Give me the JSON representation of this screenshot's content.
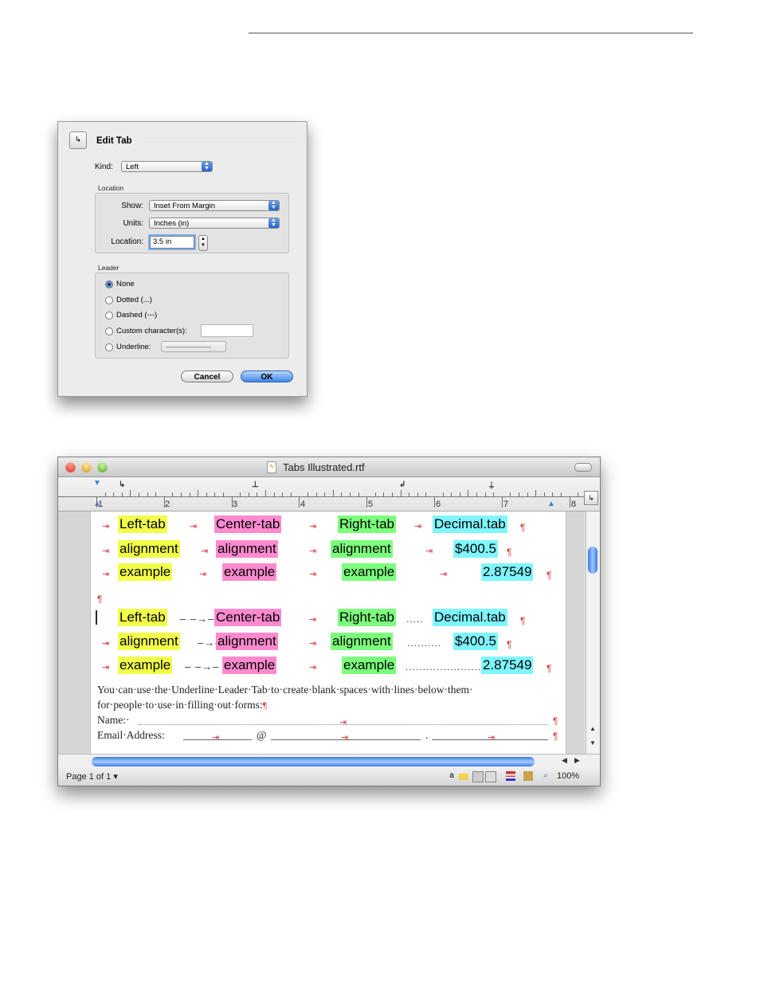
{
  "dialog": {
    "title": "Edit Tab",
    "kind_label": "Kind:",
    "kind_value": "Left",
    "location_group": "Location",
    "show_label": "Show:",
    "show_value": "Inset From Margin",
    "units_label": "Units:",
    "units_value": "Inches (in)",
    "location_label": "Location:",
    "location_value": "3.5 in",
    "leader_group": "Leader",
    "leaders": [
      {
        "label": "None",
        "selected": true
      },
      {
        "label": "Dotted (...)",
        "selected": false
      },
      {
        "label": "Dashed (---)",
        "selected": false
      },
      {
        "label": "Custom character(s):",
        "selected": false
      },
      {
        "label": "Underline:",
        "selected": false
      }
    ],
    "cancel_label": "Cancel",
    "ok_label": "OK"
  },
  "window": {
    "title": "Tabs Illustrated.rtf",
    "ruler_numbers": [
      "1",
      "2",
      "3",
      "4",
      "5",
      "6",
      "7",
      "8"
    ],
    "status": {
      "page_count": "Page 1 of 1 ▾",
      "zoom": "100%"
    }
  },
  "document": {
    "block1": [
      {
        "left": "Left-tab",
        "center": "Center-tab",
        "right": "Right-tab",
        "decimal": "Decimal.tab"
      },
      {
        "left": "alignment",
        "center": "alignment",
        "right": "alignment",
        "decimal": "$400.5"
      },
      {
        "left": "example",
        "center": "example",
        "right": "example",
        "decimal": "2.87549"
      }
    ],
    "block2": [
      {
        "left": "Left-tab",
        "center": "Center-tab",
        "right": "Right-tab",
        "decimal": "Decimal.tab"
      },
      {
        "left": "alignment",
        "center": "alignment",
        "right": "alignment",
        "decimal": "$400.5"
      },
      {
        "left": "example",
        "center": "example",
        "right": "example",
        "decimal": "2.87549"
      }
    ],
    "para_line1": "You·can·use·the·Underline·Leader·Tab·to·create·blank·spaces·with·lines·below·them·",
    "para_line2": "for·people·to·use·in·filling·out·forms:",
    "name_label": "Name:·",
    "email_label": "Email·Address:",
    "at_sign": "@",
    "dot_sign": ".",
    "pilcrow": "¶",
    "tab_arrow": "⇥"
  },
  "colors": {
    "left_highlight": "#f2ff4a",
    "center_highlight": "#ff8ad0",
    "right_highlight": "#7cff7c",
    "decimal_highlight": "#7ff6ff",
    "mark_color": "#d23a3a"
  }
}
